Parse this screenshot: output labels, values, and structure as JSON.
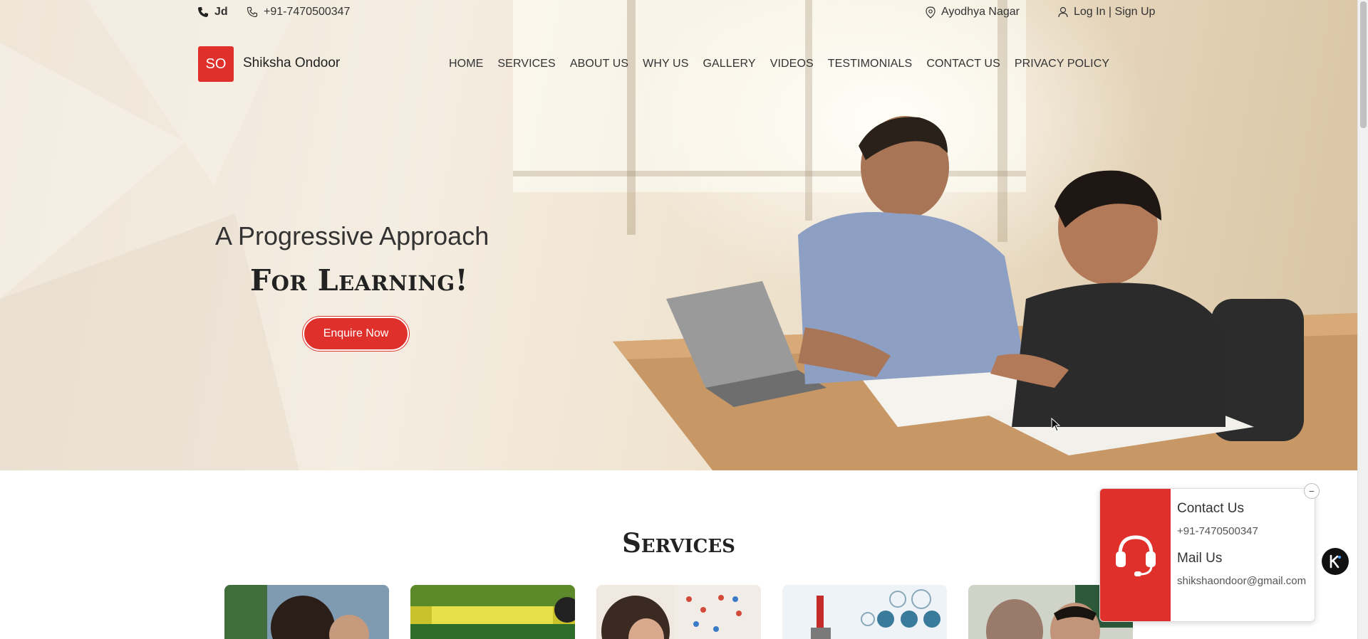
{
  "topbar": {
    "jd_label": "Jd",
    "phone": "+91-7470500347",
    "location": "Ayodhya Nagar",
    "auth": "Log In | Sign Up"
  },
  "brand": {
    "logo_text": "SO",
    "name": "Shiksha Ondoor"
  },
  "nav": {
    "items": [
      "HOME",
      "SERVICES",
      "ABOUT US",
      "WHY US",
      "GALLERY",
      "VIDEOS",
      "TESTIMONIALS",
      "CONTACT US",
      "PRIVACY POLICY"
    ]
  },
  "hero": {
    "line1": "A Progressive Approach",
    "line2": "For Learning!",
    "cta": "Enquire Now"
  },
  "services": {
    "title": "Services"
  },
  "contact_widget": {
    "contact_heading": "Contact Us",
    "contact_phone": "+91-7470500347",
    "mail_heading": "Mail Us",
    "mail_address": "shikshaondoor@gmail.com",
    "close_symbol": "−"
  },
  "colors": {
    "accent": "#e0302b"
  }
}
